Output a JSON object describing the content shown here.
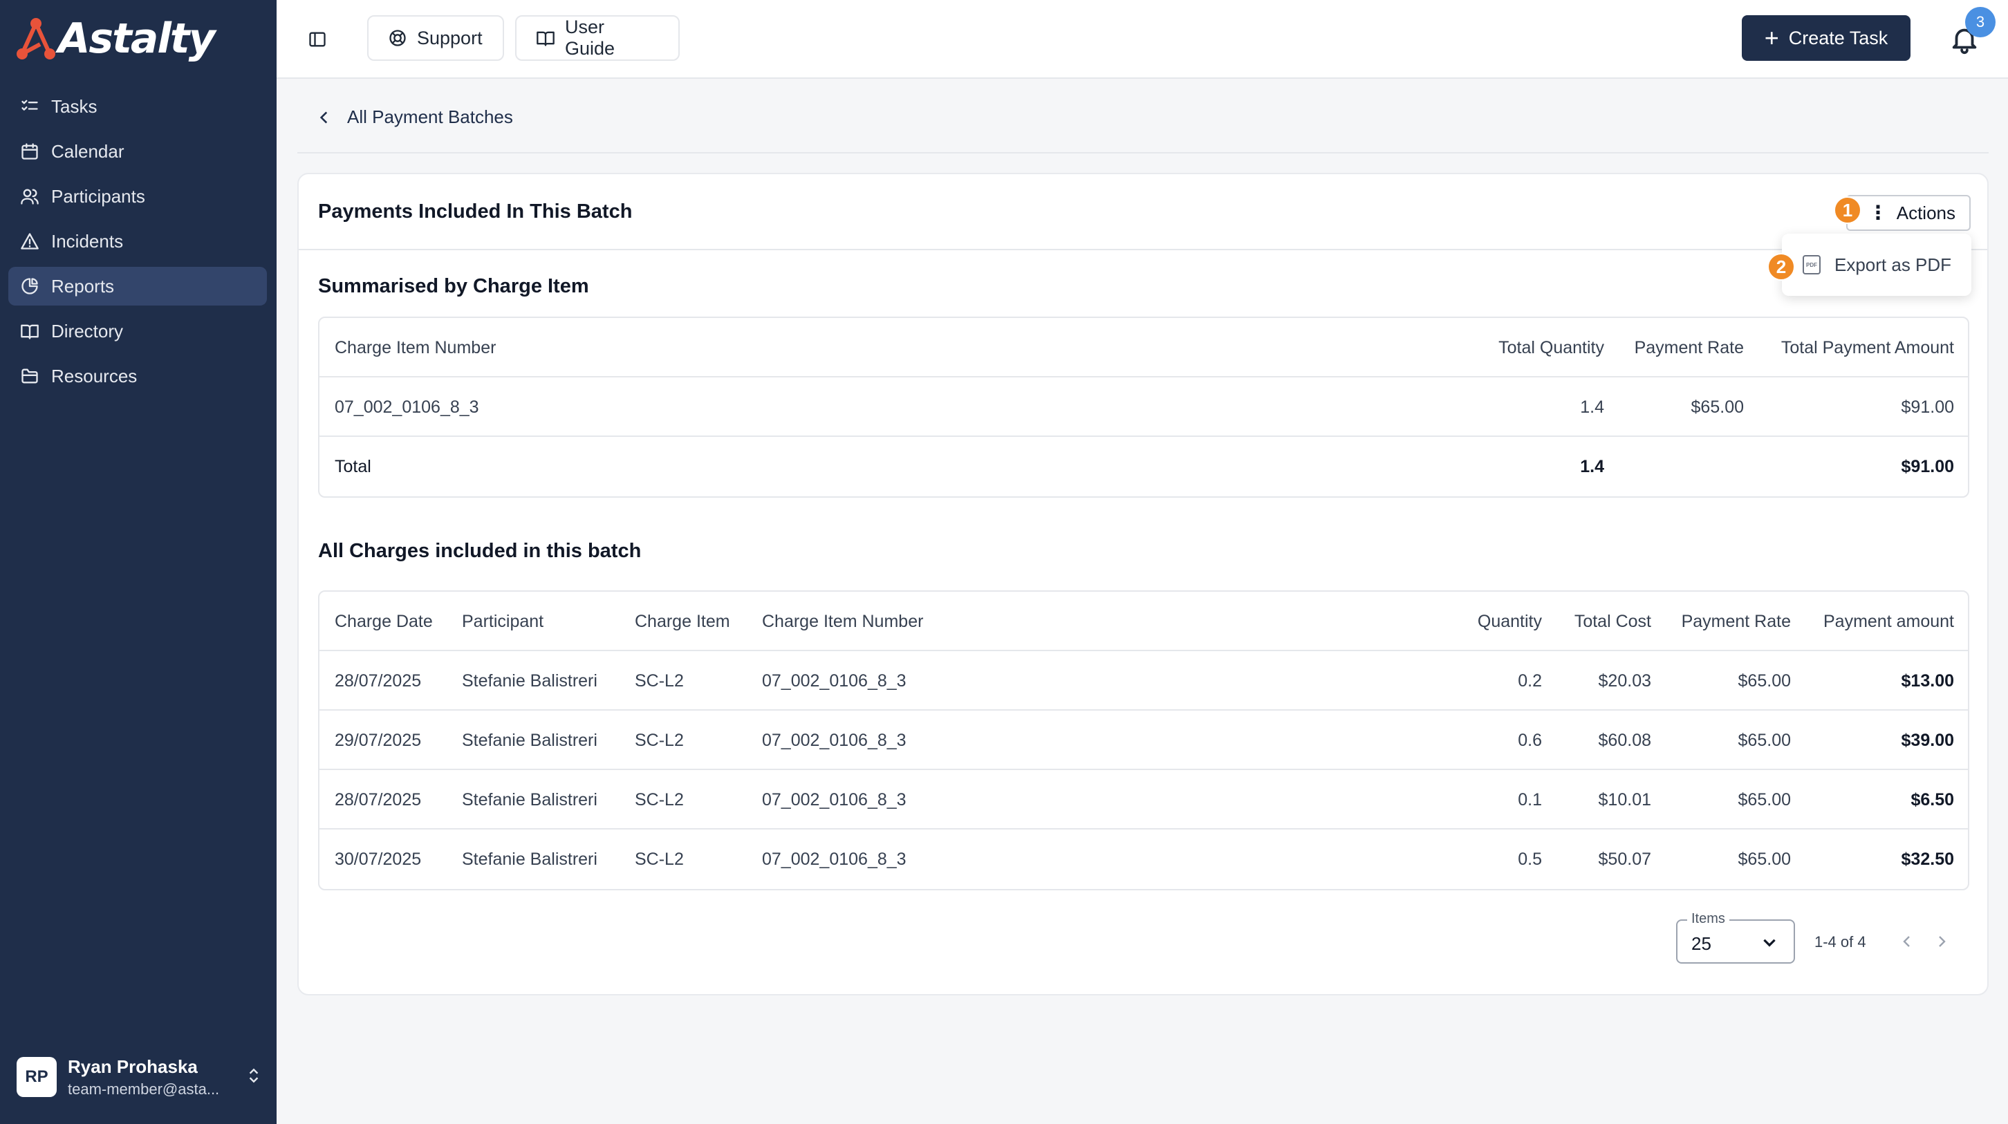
{
  "app": {
    "logo_text": "Astalty"
  },
  "sidebar": {
    "items": [
      {
        "label": "Tasks",
        "icon": "list-check-icon"
      },
      {
        "label": "Calendar",
        "icon": "calendar-icon"
      },
      {
        "label": "Participants",
        "icon": "users-icon"
      },
      {
        "label": "Incidents",
        "icon": "warning-icon"
      },
      {
        "label": "Reports",
        "icon": "pie-chart-icon",
        "active": true
      },
      {
        "label": "Directory",
        "icon": "book-open-icon"
      },
      {
        "label": "Resources",
        "icon": "folder-icon"
      }
    ],
    "user": {
      "initials": "RP",
      "name": "Ryan Prohaska",
      "email": "team-member@asta..."
    }
  },
  "topbar": {
    "support_label": "Support",
    "guide_label": "User Guide",
    "create_label": "Create Task",
    "notifications_count": "3"
  },
  "breadcrumb": {
    "back_label": "All Payment Batches"
  },
  "card": {
    "title": "Payments Included In This Batch",
    "actions_label": "Actions",
    "marker_1": "1",
    "marker_2": "2",
    "dropdown_item": "Export as PDF",
    "pdf_icon_text": "PDF"
  },
  "summary": {
    "title": "Summarised by Charge Item",
    "headers": [
      "Charge Item Number",
      "Total Quantity",
      "Payment Rate",
      "Total Payment Amount"
    ],
    "rows": [
      [
        "07_002_0106_8_3",
        "1.4",
        "$65.00",
        "$91.00"
      ]
    ],
    "total": [
      "Total",
      "1.4",
      "",
      "$91.00"
    ]
  },
  "charges": {
    "title": "All Charges included in this batch",
    "headers": [
      "Charge Date",
      "Participant",
      "Charge Item",
      "Charge Item Number",
      "Quantity",
      "Total Cost",
      "Payment Rate",
      "Payment amount"
    ],
    "rows": [
      [
        "28/07/2025",
        "Stefanie Balistreri",
        "SC-L2",
        "07_002_0106_8_3",
        "0.2",
        "$20.03",
        "$65.00",
        "$13.00"
      ],
      [
        "29/07/2025",
        "Stefanie Balistreri",
        "SC-L2",
        "07_002_0106_8_3",
        "0.6",
        "$60.08",
        "$65.00",
        "$39.00"
      ],
      [
        "28/07/2025",
        "Stefanie Balistreri",
        "SC-L2",
        "07_002_0106_8_3",
        "0.1",
        "$10.01",
        "$65.00",
        "$6.50"
      ],
      [
        "30/07/2025",
        "Stefanie Balistreri",
        "SC-L2",
        "07_002_0106_8_3",
        "0.5",
        "$50.07",
        "$65.00",
        "$32.50"
      ]
    ]
  },
  "pagination": {
    "items_label": "Items",
    "items_value": "25",
    "range": "1-4 of 4"
  },
  "colors": {
    "sidebar_bg": "#1f2e4a",
    "accent": "#1f2e4a",
    "marker": "#f08a24",
    "badge": "#4a90e2"
  }
}
